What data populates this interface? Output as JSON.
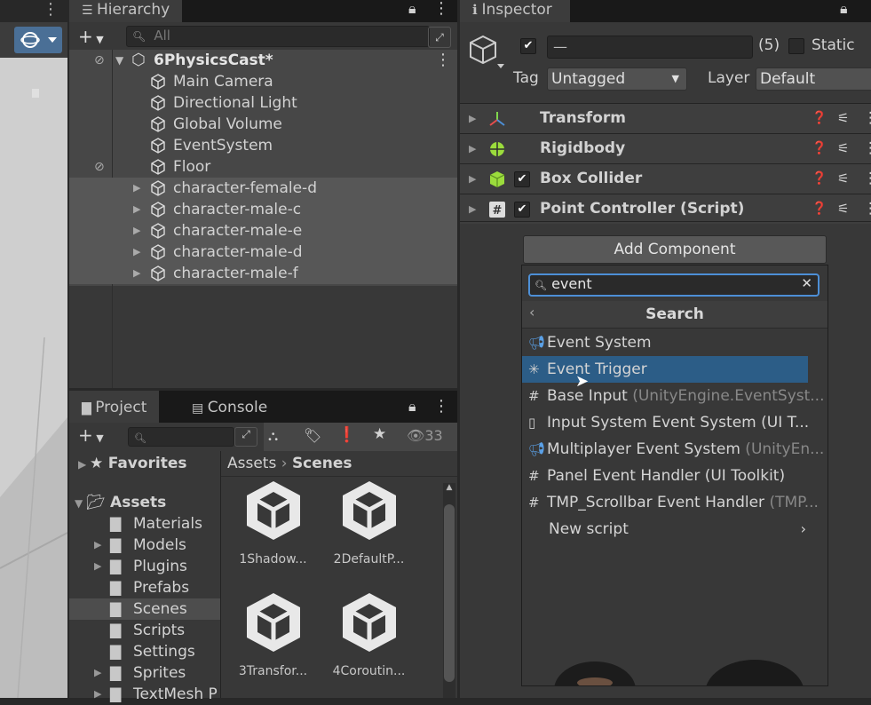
{
  "hierarchy": {
    "tab_label": "Hierarchy",
    "search_placeholder": "All",
    "scene_name": "6PhysicsCast*",
    "items": [
      "Main Camera",
      "Directional Light",
      "Global Volume",
      "EventSystem",
      "Floor"
    ],
    "characters": [
      "character-female-d",
      "character-male-c",
      "character-male-e",
      "character-male-d",
      "character-male-f"
    ]
  },
  "inspector": {
    "tab_label": "Inspector",
    "name_value": "—",
    "count": "(5)",
    "static_label": "Static",
    "tag_label": "Tag",
    "tag_value": "Untagged",
    "layer_label": "Layer",
    "layer_value": "Default",
    "components": [
      "Transform",
      "Rigidbody",
      "Box Collider",
      "Point Controller (Script)"
    ],
    "add_component_label": "Add Component"
  },
  "popup": {
    "search_value": "event",
    "title": "Search",
    "items": [
      {
        "label": "Event System",
        "hint": ""
      },
      {
        "label": "Event Trigger",
        "hint": ""
      },
      {
        "label": "Base Input",
        "hint": " (UnityEngine.EventSyst..."
      },
      {
        "label": "Input System Event System (UI T...",
        "hint": ""
      },
      {
        "label": "Multiplayer Event System",
        "hint": " (UnityEn..."
      },
      {
        "label": "Panel Event Handler (UI Toolkit)",
        "hint": ""
      },
      {
        "label": "TMP_Scrollbar Event Handler",
        "hint": " (TMP..."
      }
    ],
    "new_script_label": "New script"
  },
  "project": {
    "tab_project": "Project",
    "tab_console": "Console",
    "hidden_count": "33",
    "favorites_label": "Favorites",
    "assets_label": "Assets",
    "folders": [
      "Materials",
      "Models",
      "Plugins",
      "Prefabs",
      "Scenes",
      "Scripts",
      "Settings",
      "Sprites",
      "TextMesh P"
    ],
    "breadcrumb_root": "Assets",
    "breadcrumb_current": "Scenes",
    "scene_assets": [
      "1Shadow...",
      "2DefaultP...",
      "3Transfor...",
      "4Coroutin..."
    ]
  },
  "colors": {
    "selection": "#2c5d87",
    "accent_blue": "#4d8fd6"
  }
}
